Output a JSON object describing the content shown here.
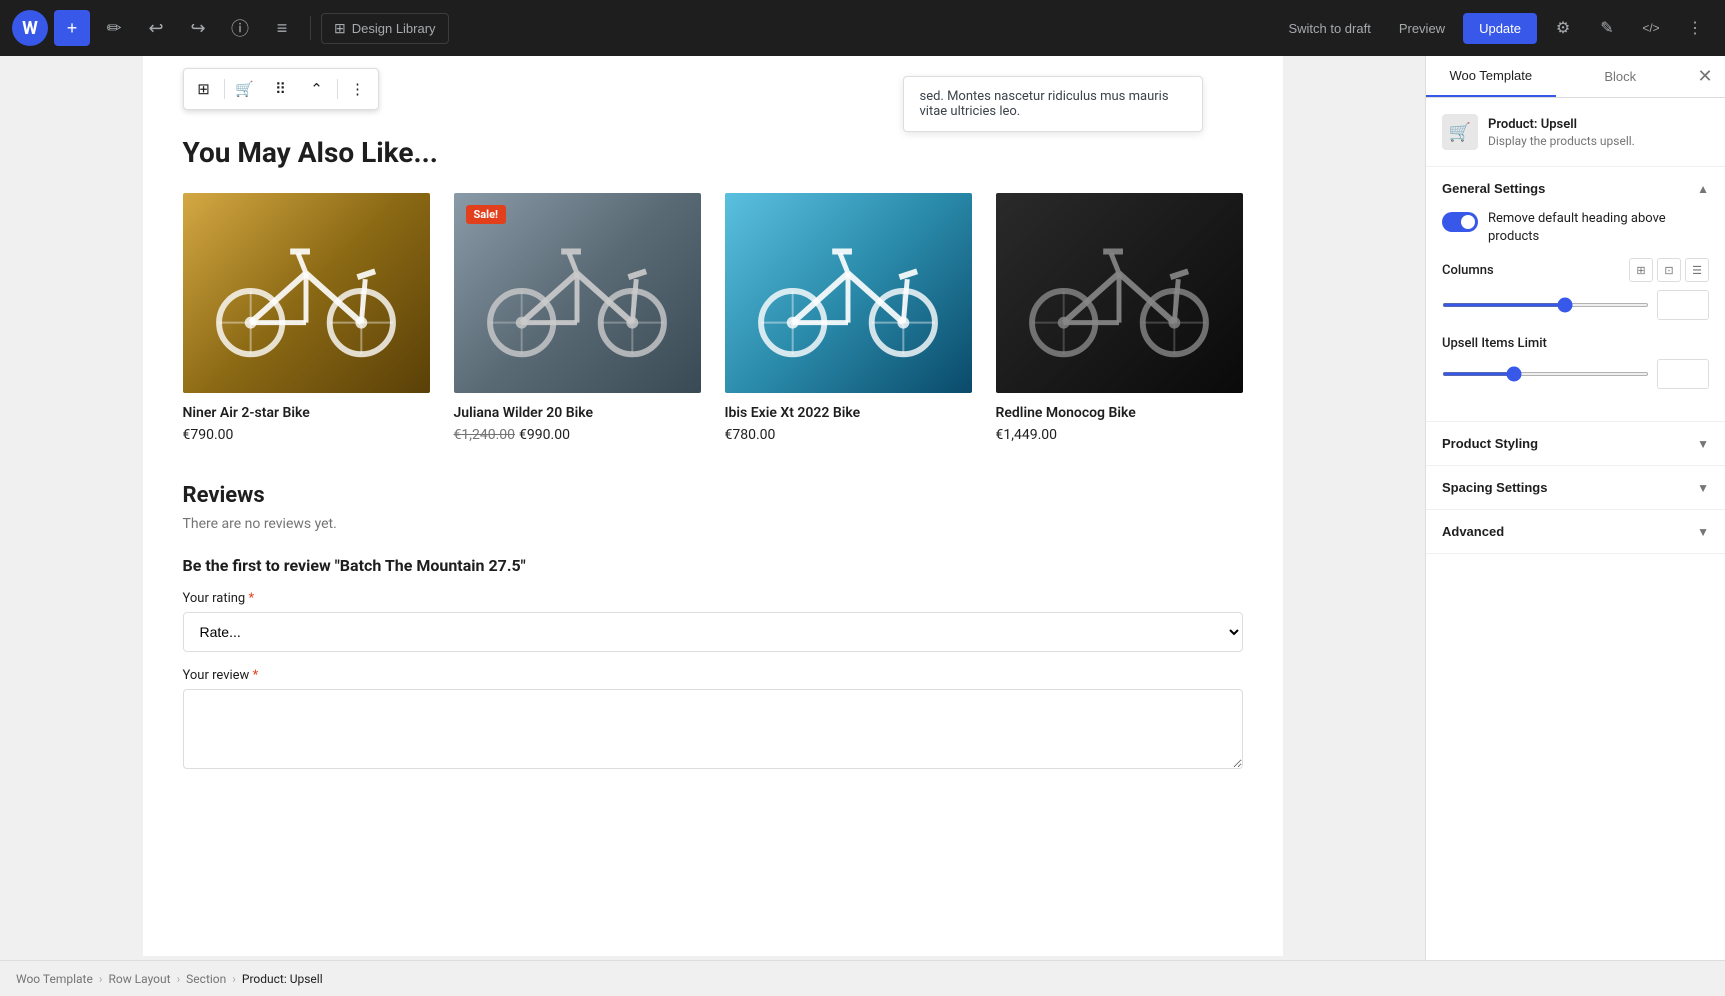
{
  "toolbar": {
    "wp_logo": "W",
    "add_button": "+",
    "pencil_button": "✏",
    "undo_button": "↩",
    "redo_button": "↪",
    "info_button": "ⓘ",
    "list_button": "≡",
    "design_library_label": "Design Library",
    "switch_draft_label": "Switch to draft",
    "preview_label": "Preview",
    "update_label": "Update",
    "gear_icon": "⚙",
    "edit_icon": "✎",
    "code_icon": "⟨/⟩",
    "more_icon": "⋮"
  },
  "block_toolbar": {
    "icon1": "⊞",
    "icon2": "🛒",
    "icon3": "⠿",
    "icon4": "⌃",
    "more_icon": "⋮"
  },
  "canvas": {
    "tooltip_text": "sed. Montes nascetur ridiculus mus mauris vitae ultricies leo.",
    "section_heading": "You May Also Like...",
    "products": [
      {
        "id": 1,
        "name": "Niner Air 2-star Bike",
        "price": "€790.00",
        "old_price": "",
        "sale": false,
        "color_class": "bike1"
      },
      {
        "id": 2,
        "name": "Juliana Wilder 20 Bike",
        "price": "€990.00",
        "old_price": "€1,240.00",
        "sale": true,
        "color_class": "bike2"
      },
      {
        "id": 3,
        "name": "Ibis Exie Xt 2022 Bike",
        "price": "€780.00",
        "old_price": "",
        "sale": false,
        "color_class": "bike3"
      },
      {
        "id": 4,
        "name": "Redline Monocog Bike",
        "price": "€1,449.00",
        "old_price": "",
        "sale": false,
        "color_class": "bike4"
      }
    ],
    "sale_badge": "Sale!",
    "reviews": {
      "heading": "Reviews",
      "no_reviews": "There are no reviews yet.",
      "form_heading": "Be the first to review \"Batch The Mountain 27.5\"",
      "rating_label": "Your rating",
      "rating_required": "*",
      "rating_placeholder": "Rate...",
      "review_label": "Your review",
      "review_required": "*"
    }
  },
  "right_panel": {
    "tab_woo_template": "Woo Template",
    "tab_block": "Block",
    "close_icon": "✕",
    "product_upsell": {
      "title": "Product: Upsell",
      "description": "Display the products upsell."
    },
    "general_settings": {
      "label": "General Settings",
      "toggle_label": "Remove default heading above products",
      "toggle_active": true,
      "columns_label": "Columns",
      "columns_value": "4",
      "upsell_limit_label": "Upsell Items Limit",
      "upsell_limit_value": "4"
    },
    "product_styling": {
      "label": "Product Styling"
    },
    "spacing_settings": {
      "label": "Spacing Settings"
    },
    "advanced": {
      "label": "Advanced"
    }
  },
  "breadcrumb": {
    "items": [
      "Woo Template",
      "Row Layout",
      "Section",
      "Product: Upsell"
    ],
    "separators": [
      ">",
      ">",
      ">"
    ]
  }
}
